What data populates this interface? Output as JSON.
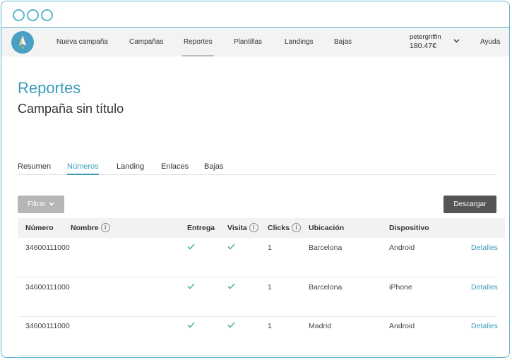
{
  "window": {
    "control_count": 3
  },
  "nav": {
    "items": [
      {
        "label": "Nueva campaña"
      },
      {
        "label": "Campañas"
      },
      {
        "label": "Reportes"
      },
      {
        "label": "Plantillas"
      },
      {
        "label": "Landings"
      },
      {
        "label": "Bajas"
      }
    ],
    "active": "Reportes",
    "user": {
      "name": "petergriffin",
      "balance": "180.47€"
    },
    "help": "Ayuda"
  },
  "page": {
    "title": "Reportes",
    "subtitle": "Campaña sin título"
  },
  "tabs": [
    {
      "label": "Resumen"
    },
    {
      "label": "Números"
    },
    {
      "label": "Landing"
    },
    {
      "label": "Enlaces"
    },
    {
      "label": "Bajas"
    }
  ],
  "active_tab": "Números",
  "toolbar": {
    "filter_label": "Filtrar",
    "download_label": "Descargar"
  },
  "table": {
    "headers": {
      "numero": "Número",
      "nombre": "Nombre",
      "entrega": "Entrega",
      "visita": "Visita",
      "clicks": "Clicks",
      "ubicacion": "Ubicación",
      "dispositivo": "Dispositivo"
    },
    "rows": [
      {
        "numero": "34600111000",
        "nombre": "",
        "entrega": true,
        "visita": true,
        "clicks": "1",
        "ubicacion": "Barcelona",
        "dispositivo": "Android",
        "details": "Detalles"
      },
      {
        "numero": "34600111000",
        "nombre": "",
        "entrega": true,
        "visita": true,
        "clicks": "1",
        "ubicacion": "Barcelona",
        "dispositivo": "iPhone",
        "details": "Detalles"
      },
      {
        "numero": "34600111000",
        "nombre": "",
        "entrega": true,
        "visita": true,
        "clicks": "1",
        "ubicacion": "Madrid",
        "dispositivo": "Android",
        "details": "Detalles"
      }
    ]
  },
  "colors": {
    "accent": "#3b9bb8",
    "check": "#4fb39a",
    "frame": "#5db4cc"
  }
}
